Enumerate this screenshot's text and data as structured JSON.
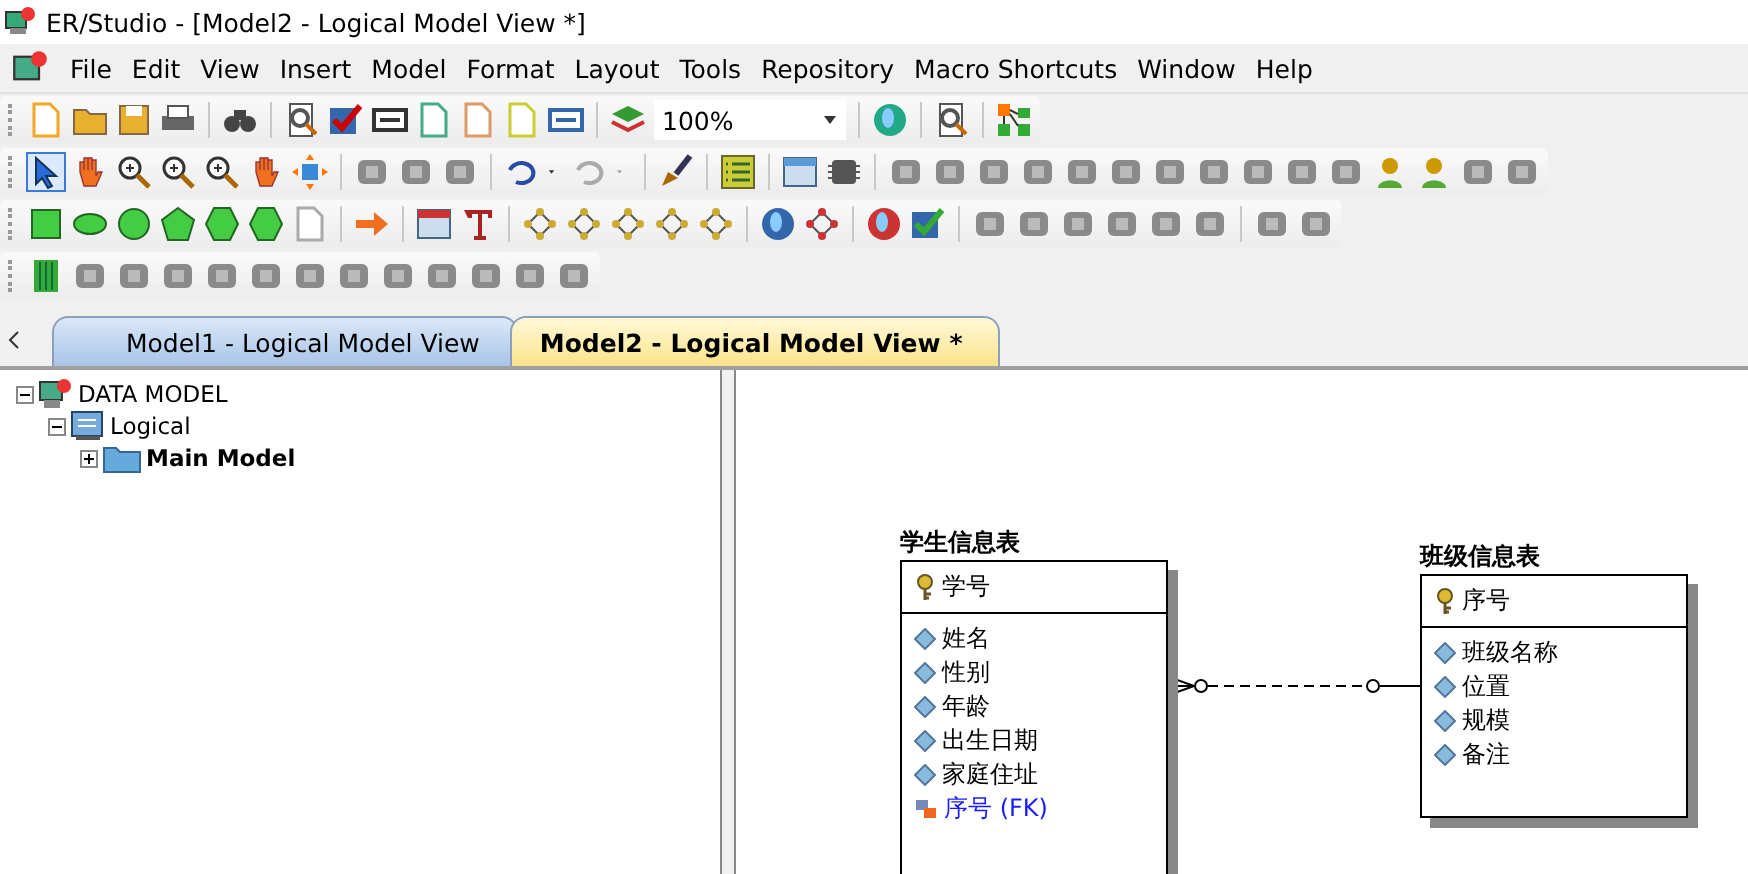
{
  "window": {
    "title": "ER/Studio - [Model2 - Logical Model View *]"
  },
  "menu": [
    "File",
    "Edit",
    "View",
    "Insert",
    "Model",
    "Format",
    "Layout",
    "Tools",
    "Repository",
    "Macro Shortcuts",
    "Window",
    "Help"
  ],
  "zoom": {
    "value": "100%"
  },
  "tabs": [
    {
      "label": "Model1 - Logical Model View",
      "selected": false
    },
    {
      "label": "Model2 - Logical Model View *",
      "selected": true
    }
  ],
  "tree": [
    {
      "label": "DATA MODEL",
      "kind": "root",
      "expanded": true,
      "children": [
        {
          "label": "Logical",
          "kind": "model",
          "expanded": true,
          "children": [
            {
              "label": "Main Model",
              "kind": "folder",
              "expanded": false
            }
          ]
        }
      ]
    }
  ],
  "entities": [
    {
      "name": "学生信息表",
      "keys": [
        "学号"
      ],
      "attributes": [
        {
          "name": "姓名",
          "kind": "attribute"
        },
        {
          "name": "性别",
          "kind": "attribute"
        },
        {
          "name": "年龄",
          "kind": "attribute"
        },
        {
          "name": "出生日期",
          "kind": "attribute"
        },
        {
          "name": "家庭住址",
          "kind": "attribute"
        },
        {
          "name": "序号 (FK)",
          "kind": "foreign_key"
        }
      ]
    },
    {
      "name": "班级信息表",
      "keys": [
        "序号"
      ],
      "attributes": [
        {
          "name": "班级名称",
          "kind": "attribute"
        },
        {
          "name": "位置",
          "kind": "attribute"
        },
        {
          "name": "规模",
          "kind": "attribute"
        },
        {
          "name": "备注",
          "kind": "attribute"
        }
      ]
    }
  ]
}
